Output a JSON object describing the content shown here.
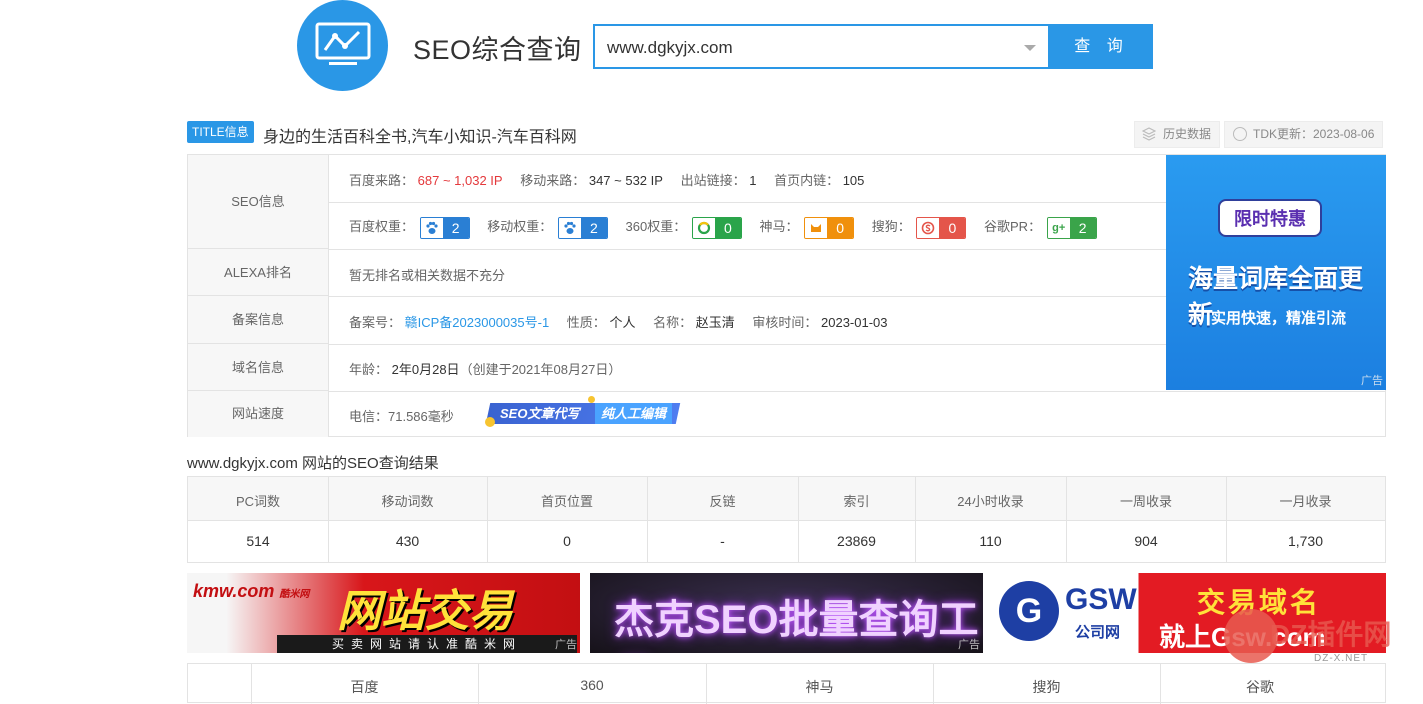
{
  "header": {
    "brand": "SEO综合查询",
    "search_value": "www.dgkyjx.com",
    "search_button": "查 询"
  },
  "title_row": {
    "tag": "TITLE信息",
    "title": "身边的生活百科全书,汽车小知识-汽车百科网",
    "history_btn": "历史数据",
    "tdk_update": "TDK更新：2023-08-06"
  },
  "seo_info": {
    "label": "SEO信息",
    "baidu_traffic_label": "百度来路：",
    "baidu_traffic_value": "687 ~ 1,032 IP",
    "mobile_traffic_label": "移动来路：",
    "mobile_traffic_value": "347 ~ 532 IP",
    "outlinks_label": "出站链接：",
    "outlinks_value": "1",
    "inlinks_label": "首页内链：",
    "inlinks_value": "105",
    "weights": [
      {
        "label": "百度权重：",
        "value": "2",
        "color": "#2a7fd4",
        "icon": "baidu-paw-icon"
      },
      {
        "label": "移动权重：",
        "value": "2",
        "color": "#2a7fd4",
        "icon": "mobile-paw-icon"
      },
      {
        "label": "360权重：",
        "value": "0",
        "color": "#2aa44a",
        "icon": "360-ring-icon"
      },
      {
        "label": "神马：",
        "value": "0",
        "color": "#f0900c",
        "icon": "shenma-icon"
      },
      {
        "label": "搜狗：",
        "value": "0",
        "color": "#e4554a",
        "icon": "sogou-icon"
      },
      {
        "label": "谷歌PR：",
        "value": "2",
        "color": "#3aa44a",
        "icon": "google-plus-icon"
      }
    ]
  },
  "alexa": {
    "label": "ALEXA排名",
    "value": "暂无排名或相关数据不充分"
  },
  "beian": {
    "label": "备案信息",
    "num_label": "备案号：",
    "num_value": "赣ICP备2023000035号-1",
    "nature_label": "性质：",
    "nature_value": "个人",
    "name_label": "名称：",
    "name_value": "赵玉清",
    "audit_label": "审核时间：",
    "audit_value": "2023-01-03"
  },
  "domain": {
    "label": "域名信息",
    "age_label": "年龄：",
    "age_value": "2年0月28日",
    "created": "（创建于2021年08月27日）"
  },
  "speed": {
    "label": "网站速度",
    "value": "电信：71.586毫秒",
    "ad_text_1": "SEO文章代写",
    "ad_text_2": "纯人工编辑"
  },
  "right_ad": {
    "tag": "限时特惠",
    "headline": "海量词库全面更新",
    "sub": "实用快速，精准引流",
    "ad_label": "广告"
  },
  "results": {
    "title": "www.dgkyjx.com 网站的SEO查询结果",
    "headers": [
      "PC词数",
      "移动词数",
      "首页位置",
      "反链",
      "索引",
      "24小时收录",
      "一周收录",
      "一月收录"
    ],
    "values": [
      "514",
      "430",
      "0",
      "-",
      "23869",
      "110",
      "904",
      "1,730"
    ]
  },
  "banners": {
    "b1_logo": "kmw.com",
    "b1_logo_sub": "酷米网",
    "b1_text": "网站交易",
    "b1_bar": "买卖网站请认准酷米网",
    "b2_text": "杰克SEO批量查询工具",
    "b3_logo": "G",
    "b3_brand": "GSW",
    "b3_brand_sub": "公司网",
    "b3_t1": "交易域名",
    "b3_t2": "就上Gsw.com",
    "ad_label": "广告"
  },
  "bottom_table": {
    "headers": [
      "百度",
      "360",
      "神马",
      "搜狗",
      "谷歌"
    ]
  },
  "watermark": {
    "text": "DZ插件网",
    "url": "DZ-X.NET"
  }
}
